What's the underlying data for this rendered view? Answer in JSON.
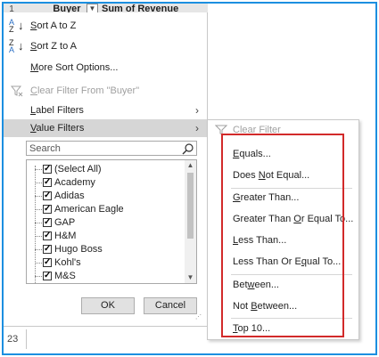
{
  "header": {
    "row_number": "1",
    "buyer_col": "Buyer",
    "dropdown_icon": "chevron-down-icon",
    "revenue_col": "Sum of Revenue"
  },
  "menu": {
    "sort_az": {
      "pre": "",
      "key": "S",
      "post": "ort A to Z"
    },
    "sort_za": {
      "pre": "",
      "key": "S",
      "post": "ort Z to A"
    },
    "more_sort": {
      "pre": "",
      "key": "M",
      "post": "ore Sort Options..."
    },
    "clear_filter": {
      "pre": "",
      "key": "C",
      "post": "lear Filter From \"Buyer\""
    },
    "label_filters": {
      "pre": "",
      "key": "L",
      "post": "abel Filters"
    },
    "value_filters": {
      "pre": "",
      "key": "V",
      "post": "alue Filters"
    }
  },
  "search": {
    "placeholder": "Search"
  },
  "list": {
    "items": [
      {
        "label": "(Select All)",
        "checked": true
      },
      {
        "label": "Academy",
        "checked": true
      },
      {
        "label": "Adidas",
        "checked": true
      },
      {
        "label": "American Eagle",
        "checked": true
      },
      {
        "label": "GAP",
        "checked": true
      },
      {
        "label": "H&M",
        "checked": true
      },
      {
        "label": "Hugo Boss",
        "checked": true
      },
      {
        "label": "Kohl's",
        "checked": true
      },
      {
        "label": "M&S",
        "checked": true
      }
    ],
    "check_glyph": "✓"
  },
  "buttons": {
    "ok": "OK",
    "cancel": "Cancel"
  },
  "bottom_row_number": "23",
  "submenu": {
    "clear_filter": "Clear Filter",
    "items": {
      "equals": {
        "pre": "",
        "key": "E",
        "post": "quals..."
      },
      "not_equal": {
        "pre": "Does ",
        "key": "N",
        "post": "ot Equal..."
      },
      "greater": {
        "pre": "",
        "key": "G",
        "post": "reater Than..."
      },
      "greater_eq": {
        "pre": "Greater Than ",
        "key": "O",
        "post": "r Equal To..."
      },
      "less": {
        "pre": "",
        "key": "L",
        "post": "ess Than..."
      },
      "less_eq": {
        "pre": "Less Than Or E",
        "key": "q",
        "post": "ual To..."
      },
      "between": {
        "pre": "Bet",
        "key": "w",
        "post": "een..."
      },
      "not_between": {
        "pre": "Not ",
        "key": "B",
        "post": "etween..."
      },
      "top10": {
        "pre": "",
        "key": "T",
        "post": "op 10..."
      }
    }
  },
  "colors": {
    "frame": "#1c8fe0",
    "highlight_box": "#d22a2a",
    "hover": "#d6d6d6"
  }
}
